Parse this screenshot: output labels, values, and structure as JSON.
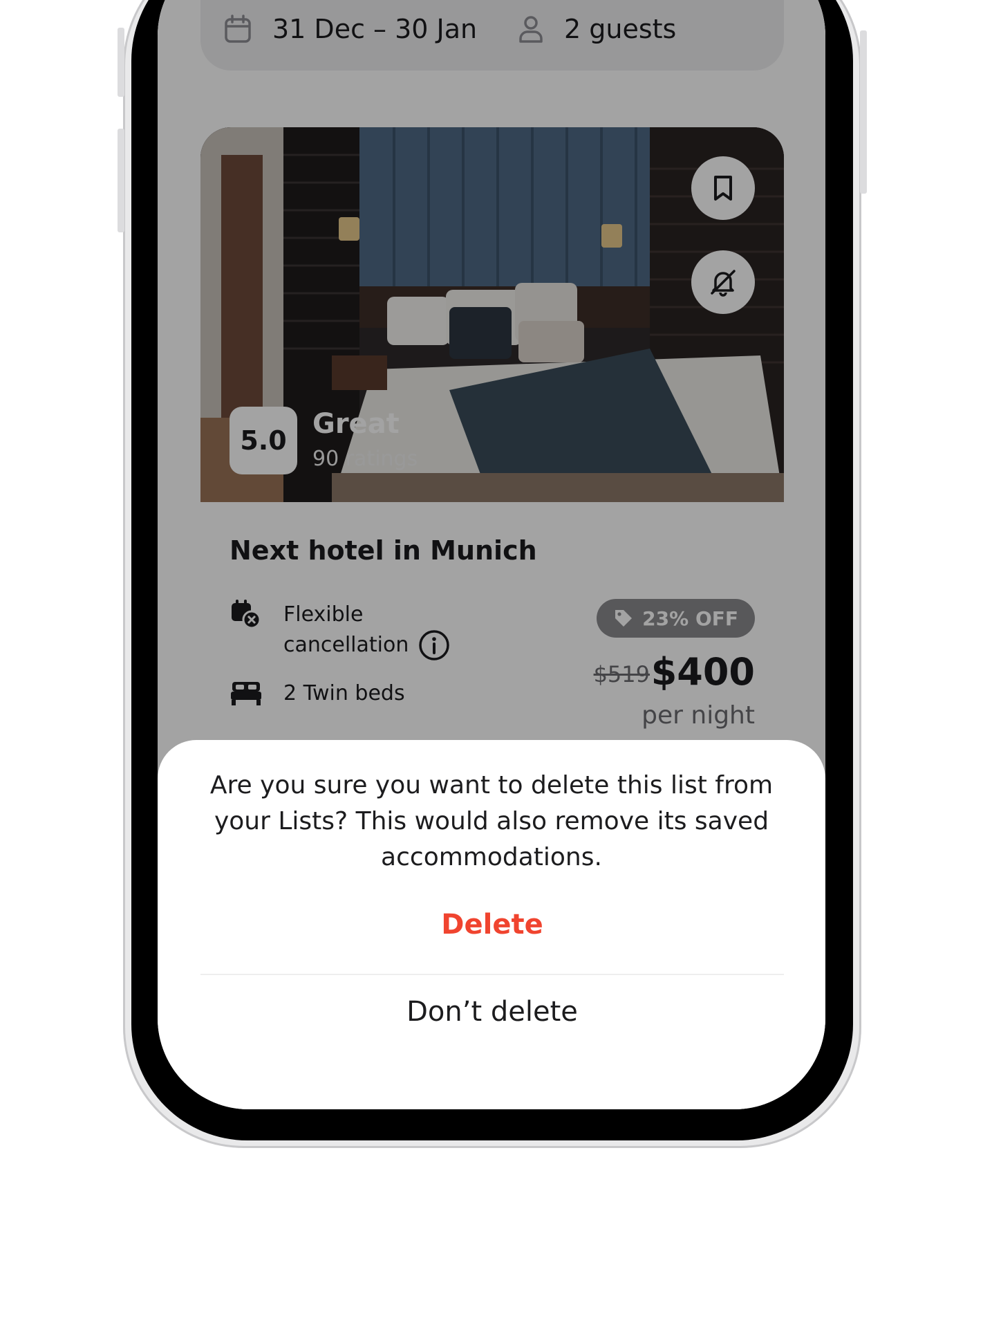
{
  "search_bar": {
    "dates": "31 Dec – 30 Jan",
    "guests": "2 guests",
    "calendar_icon": "calendar-icon",
    "person_icon": "person-icon"
  },
  "listing": {
    "rating_score": "5.0",
    "rating_label": "Great",
    "rating_count": "90 ratings",
    "hotel_name": "Next hotel in Munich",
    "features": [
      {
        "icon": "flexible-cancellation-icon",
        "label_line1": "Flexible",
        "label_line2": "cancellation"
      },
      {
        "icon": "bed-icon",
        "label_line1": "2 Twin beds"
      }
    ],
    "discount_badge": "23% OFF",
    "old_price": "$519",
    "price": "$400",
    "price_unit": "per night",
    "bookmark_icon": "bookmark-icon",
    "bell_off_icon": "bell-off-icon",
    "info_icon": "info-icon",
    "tag_icon": "tag-icon"
  },
  "dialog": {
    "message": "Are you sure you want to delete this list from your Lists? This would also remove its saved accommodations.",
    "delete_label": "Delete",
    "dont_delete_label": "Don’t delete"
  },
  "colors": {
    "destructive": "#f0442f",
    "text_primary": "#1c1c1e",
    "text_secondary": "#6b6b6f",
    "badge": "#8a8a8e",
    "scrim": "rgba(0,0,0,0.36)"
  }
}
